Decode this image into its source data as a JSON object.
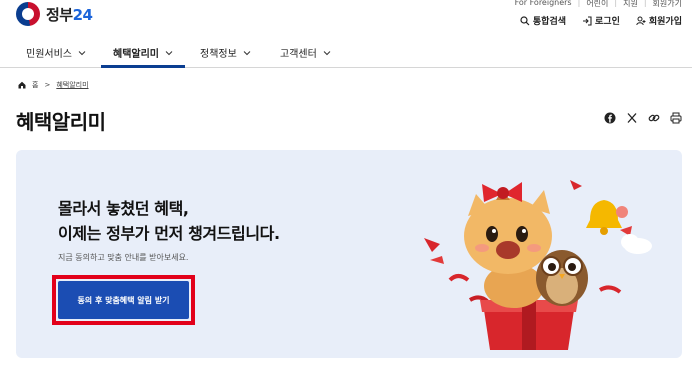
{
  "header": {
    "logo_text": "정부",
    "logo_num": "24",
    "utility_links": [
      "For Foreigners",
      "어린이",
      "지원",
      "회원가기"
    ],
    "actions": [
      {
        "label": "통합검색",
        "icon": "search-icon"
      },
      {
        "label": "로그인",
        "icon": "login-icon"
      },
      {
        "label": "회원가입",
        "icon": "user-plus-icon"
      }
    ]
  },
  "gnb": {
    "items": [
      {
        "label": "민원서비스",
        "active": false
      },
      {
        "label": "혜택알리미",
        "active": true
      },
      {
        "label": "정책정보",
        "active": false
      },
      {
        "label": "고객센터",
        "active": false
      }
    ]
  },
  "breadcrumb": {
    "home": "홈",
    "current": "혜택알리미"
  },
  "page": {
    "title": "혜택알리미"
  },
  "share": {
    "icons": [
      "facebook-icon",
      "x-icon",
      "link-icon",
      "print-icon"
    ]
  },
  "banner": {
    "headline_line1": "몰라서 놓쳤던 혜택,",
    "headline_line2": "이제는 정부가 먼저 챙겨드립니다.",
    "subtext": "지금 동의하고 맞춤 안내를 받아보세요.",
    "cta_label": "동의 후 맞춤혜택 알림 받기",
    "background": "#e8eef9",
    "cta_color": "#1b4db3",
    "highlight_color": "#e2001a"
  }
}
